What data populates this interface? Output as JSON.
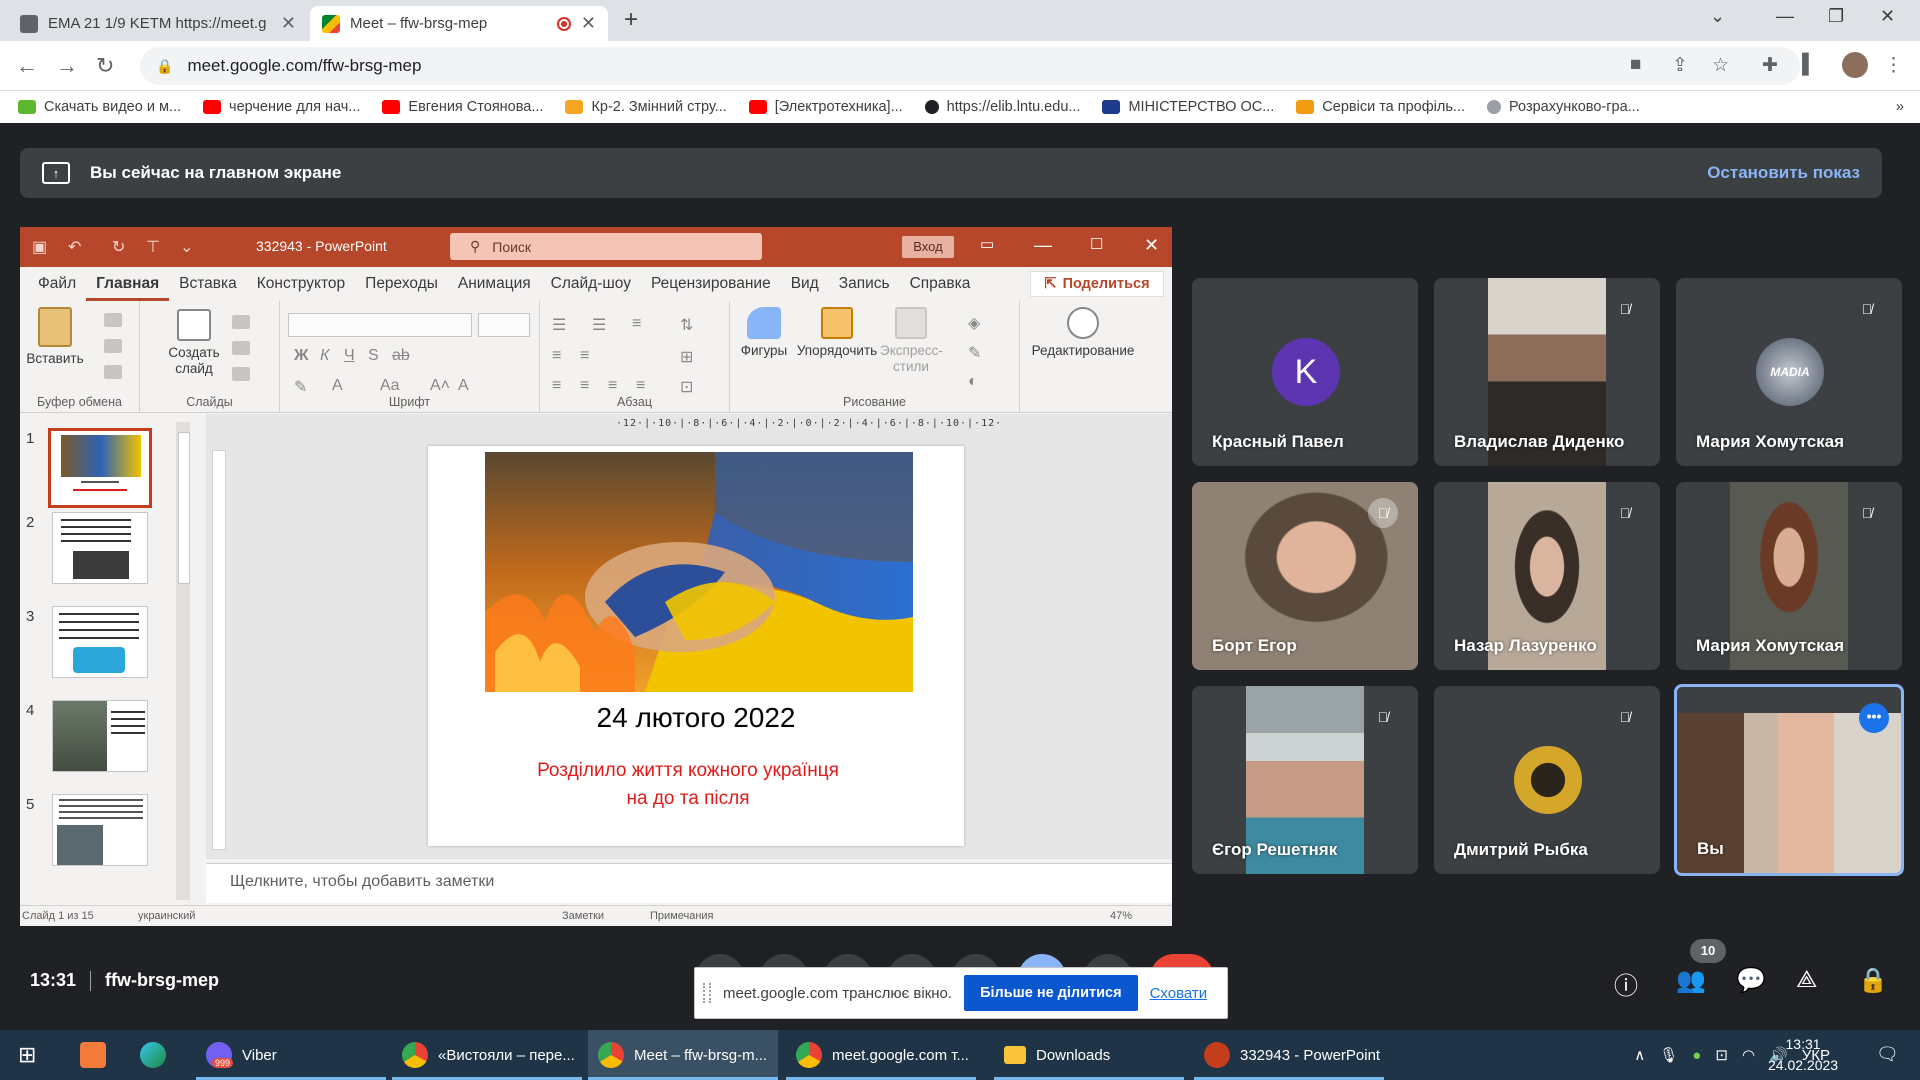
{
  "browser": {
    "tabs": [
      {
        "title": "EMA 21 1/9 KETM https://meet.g",
        "active": false
      },
      {
        "title": "Meet – ffw-brsg-mep",
        "active": true,
        "recording": true
      }
    ],
    "url": "meet.google.com/ffw-brsg-mep",
    "bookmarks": [
      {
        "label": "Скачать видео и м...",
        "icon": "green-arrow-icon",
        "color": "#5cb82f"
      },
      {
        "label": "черчение для нач...",
        "icon": "youtube-icon",
        "color": "#ff0000"
      },
      {
        "label": "Евгения Стоянова...",
        "icon": "youtube-icon",
        "color": "#ff0000"
      },
      {
        "label": "Кр-2. Змінний стру...",
        "icon": "warning-icon",
        "color": "#f5a623"
      },
      {
        "label": "[Электротехника]...",
        "icon": "youtube-icon",
        "color": "#ff0000"
      },
      {
        "label": "https://elib.lntu.edu...",
        "icon": "globe-icon",
        "color": "#202124"
      },
      {
        "label": "МІНІСТЕРСТВО ОС...",
        "icon": "d-icon",
        "color": "#1e3a8a"
      },
      {
        "label": "Сервіси та профіль...",
        "icon": "orange-grid-icon",
        "color": "#f39c12"
      },
      {
        "label": "Розрахунково-гра...",
        "icon": "gray-circle-icon",
        "color": "#9aa0a6"
      }
    ]
  },
  "meet": {
    "banner_text": "Вы сейчас на главном экране",
    "stop_presenting": "Остановить показ",
    "time": "13:31",
    "meeting_code": "ffw-brsg-mep",
    "participant_count": "10",
    "share_notice": "meet.google.com транслює вікно.",
    "stop_sharing": "Більше не ділитися",
    "hide": "Сховати",
    "participants": [
      {
        "name": "Красный Павел",
        "avatar_letter": "K",
        "avatar_color": "#5e35b1",
        "muted": false
      },
      {
        "name": "Владислав Диденко",
        "muted": true
      },
      {
        "name": "Мария Хомутская",
        "muted": true,
        "avatar_text": "MADIA"
      },
      {
        "name": "Борт Егор",
        "muted": true
      },
      {
        "name": "Назар Лазуренко",
        "muted": true
      },
      {
        "name": "Мария Хомутская",
        "muted": true
      },
      {
        "name": "Єгор Решетняк",
        "muted": true
      },
      {
        "name": "Дмитрий Рыбка",
        "muted": true
      },
      {
        "name": "Вы",
        "muted": false
      }
    ]
  },
  "ppt": {
    "title": "332943  -  PowerPoint",
    "search_placeholder": "Поиск",
    "signin": "Вход",
    "menu": [
      "Файл",
      "Главная",
      "Вставка",
      "Конструктор",
      "Переходы",
      "Анимация",
      "Слайд-шоу",
      "Рецензирование",
      "Вид",
      "Запись",
      "Справка"
    ],
    "share": "Поделиться",
    "ribbon": {
      "paste": "Вставить",
      "new_slide": "Создать слайд",
      "shapes": "Фигуры",
      "arrange": "Упорядочить",
      "quick_styles": "Экспресс-стили",
      "editing": "Редактирование",
      "groups": [
        "Буфер обмена",
        "Слайды",
        "Шрифт",
        "Абзац",
        "Рисование"
      ]
    },
    "slide_numbers": [
      "1",
      "2",
      "3",
      "4",
      "5"
    ],
    "ruler": "·12·|·10·|·8·|·6·|·4·|·2·|·0·|·2·|·4·|·6·|·8·|·10·|·12·",
    "slide": {
      "date": "24 лютого 2022",
      "line1": "Розділило життя кожного українця",
      "line2": "на до та після"
    },
    "notes_placeholder": "Щелкните, чтобы добавить заметки",
    "status": {
      "slide_info": "Слайд 1 из 15",
      "language": "украинский",
      "notes": "Заметки",
      "comments": "Примечания",
      "zoom": "47%"
    }
  },
  "taskbar": {
    "items": [
      {
        "label": "Viber",
        "badge": "999"
      },
      {
        "label": "«Вистояли – пере..."
      },
      {
        "label": "Meet – ffw-brsg-m..."
      },
      {
        "label": "meet.google.com т..."
      },
      {
        "label": "Downloads"
      },
      {
        "label": "332943 - PowerPoint"
      }
    ],
    "lang": "УКР",
    "time": "13:31",
    "date": "24.02.2023"
  }
}
